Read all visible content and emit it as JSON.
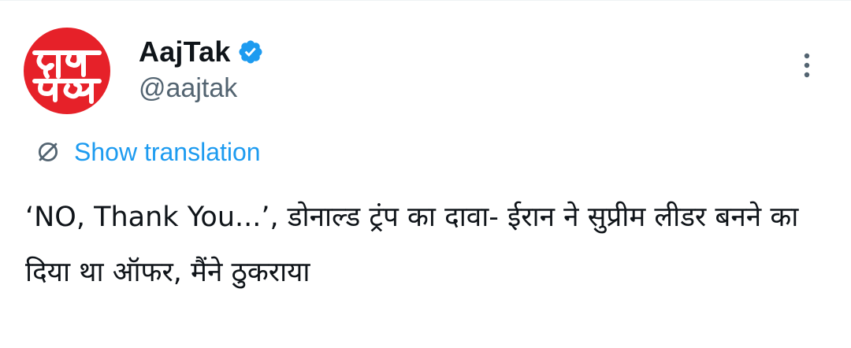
{
  "tweet": {
    "author": {
      "display_name": "AajTak",
      "handle": "@aajtak",
      "verified": true,
      "avatar_logo_text": "आज तक",
      "avatar_color": "#e62129"
    },
    "translate_link": "Show translation",
    "text": "‘NO, Thank You...’, डोनाल्ड ट्रंप का दावा- ईरान ने सुप्रीम लीडर बनने का दिया था ऑफर, मैंने ठुकराया",
    "icons": {
      "verified": "verified-badge-icon",
      "more": "more-options-icon",
      "translate": "globe-translate-icon"
    }
  },
  "colors": {
    "text_primary": "#0f1419",
    "text_secondary": "#536471",
    "accent": "#1d9bf0"
  }
}
